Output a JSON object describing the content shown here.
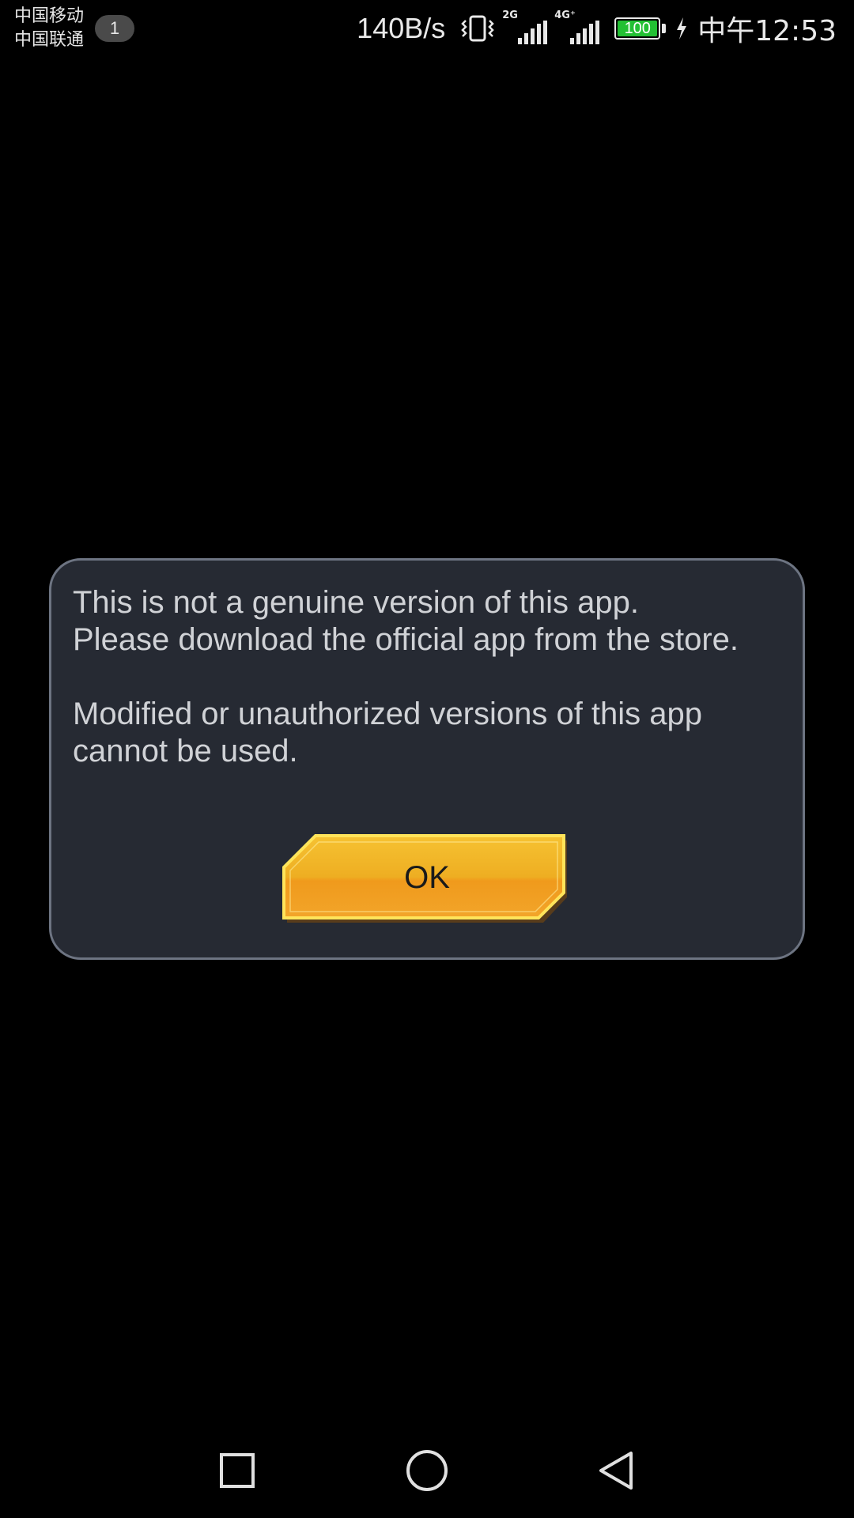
{
  "status_bar": {
    "carrier_1": "中国移动",
    "carrier_2": "中国联通",
    "notification_count": "1",
    "network_speed": "140B/s",
    "signal_1_tag": "2G",
    "signal_2_tag": "4G⁺",
    "battery_level": "100",
    "battery_color": "#22c033",
    "clock": "中午12:53",
    "icons": [
      "vibrate-icon",
      "signal-2g-icon",
      "signal-4g-icon",
      "battery-icon",
      "charging-icon"
    ]
  },
  "dialog": {
    "message_line_1": "This is not a genuine version of this app.",
    "message_line_2": "Please download the official app from the store.",
    "message_line_3": "Modified or unauthorized versions of this app",
    "message_line_4": "cannot be used.",
    "ok_label": "OK",
    "background_color": "#262a33",
    "border_color": "#6d7482",
    "button_color": "#f0a81e"
  },
  "navigation_bar": {
    "buttons": [
      "recents-icon",
      "home-icon",
      "back-icon"
    ]
  }
}
